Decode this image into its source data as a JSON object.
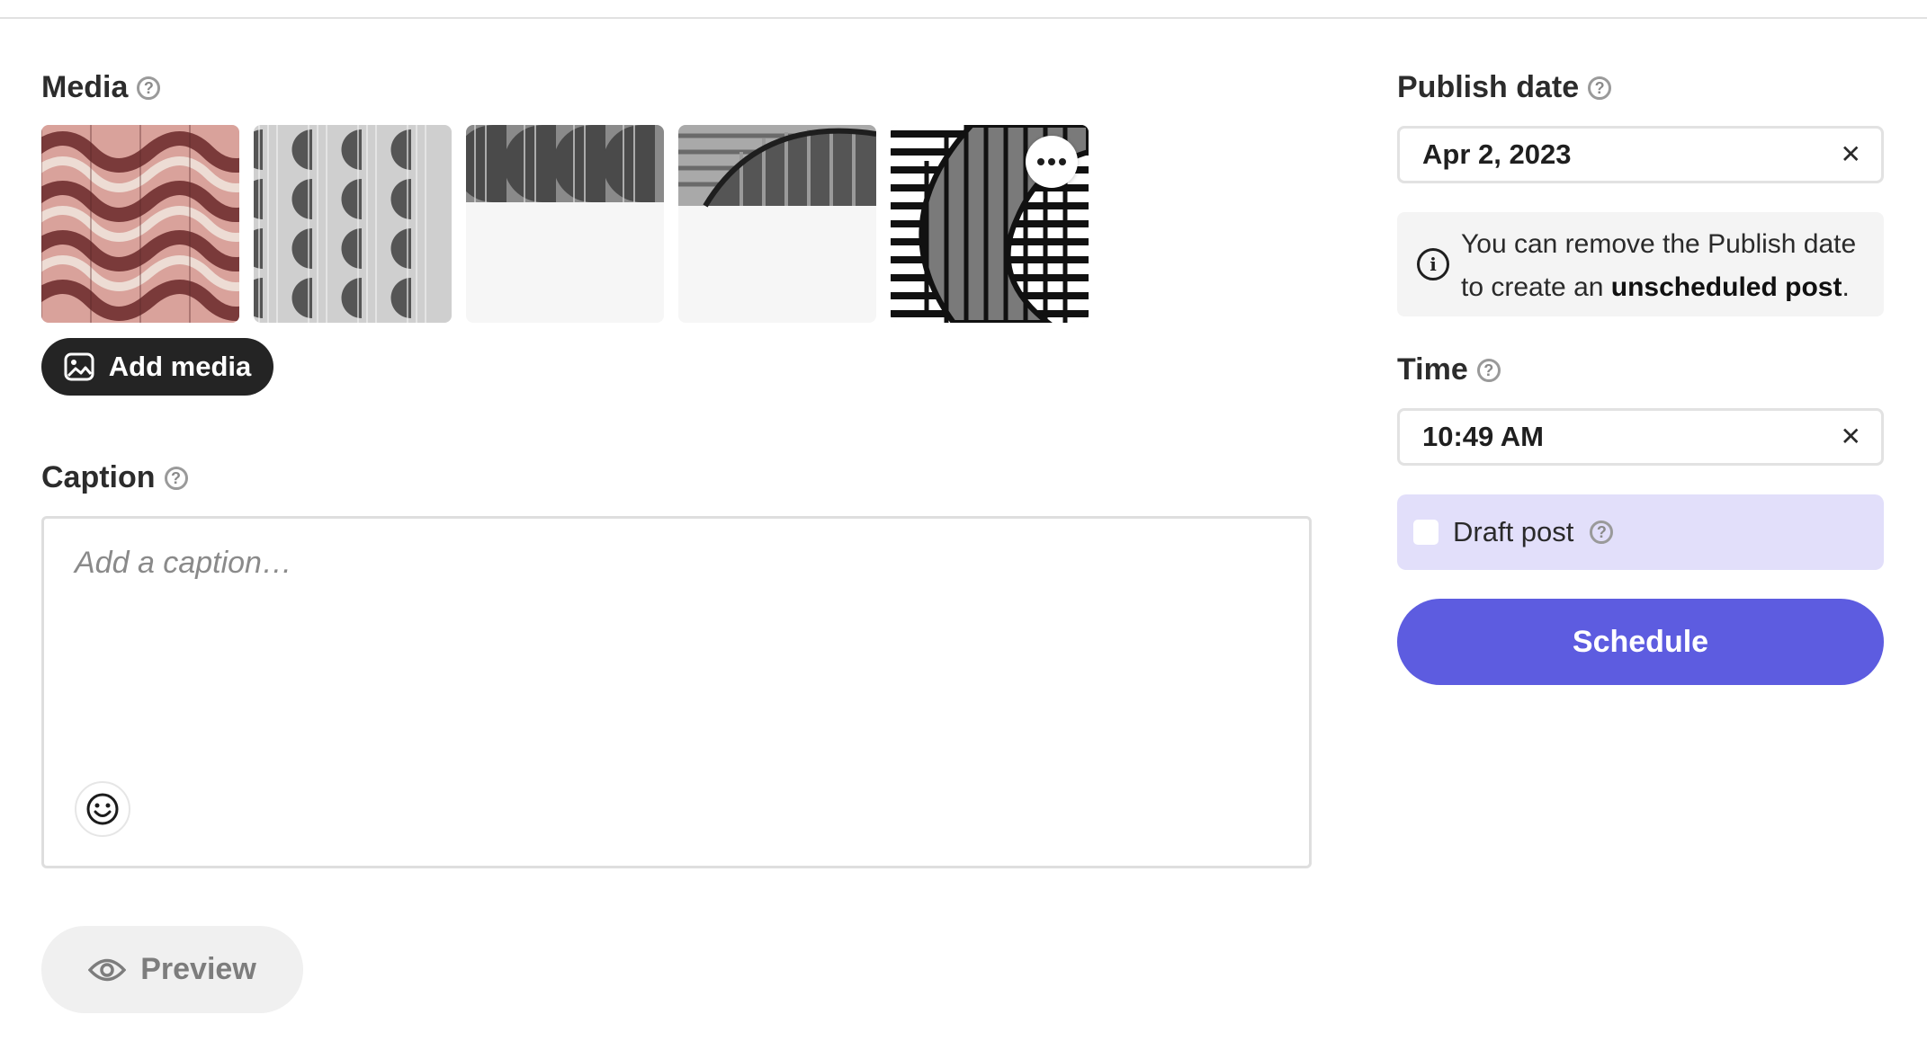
{
  "media": {
    "label": "Media",
    "thumbnail_count": 5,
    "more_icon": "more-horizontal-icon",
    "add_button_label": "Add media",
    "add_button_icon": "image-icon"
  },
  "caption": {
    "label": "Caption",
    "placeholder": "Add a caption…",
    "emoji_icon": "smiley-icon"
  },
  "preview": {
    "label": "Preview",
    "icon": "eye-icon"
  },
  "publish_date": {
    "label": "Publish date",
    "value": "Apr 2, 2023",
    "clear_icon": "close-icon"
  },
  "info": {
    "icon": "info-icon",
    "line1": "You can remove the Publish date",
    "line2_prefix": "to create an ",
    "line2_bold": "unscheduled post",
    "line2_suffix": "."
  },
  "time": {
    "label": "Time",
    "value": "10:49 AM",
    "clear_icon": "close-icon"
  },
  "draft": {
    "label": "Draft post",
    "checked": false
  },
  "schedule": {
    "label": "Schedule"
  },
  "help_glyph": "?",
  "colors": {
    "primary": "#5d5ce0",
    "draft_background": "#e2dffa",
    "dark_button": "#242424"
  }
}
